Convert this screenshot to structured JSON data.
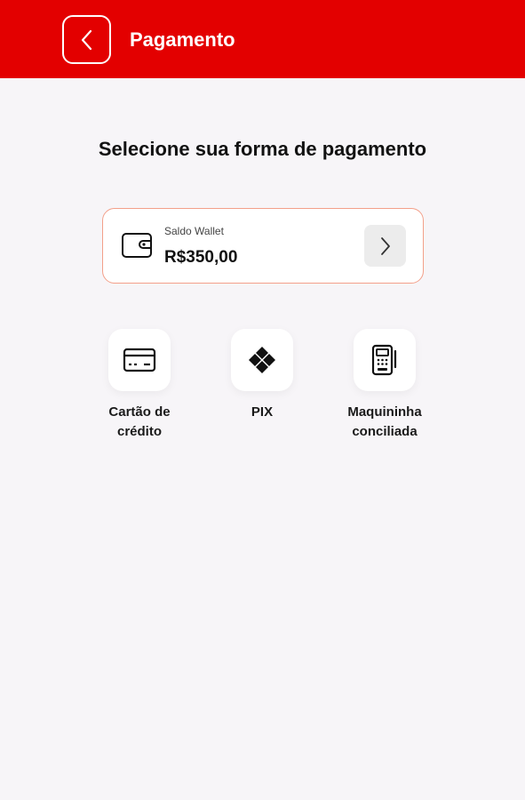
{
  "header": {
    "title": "Pagamento",
    "background": "#e30000",
    "back_icon": "chevron-left-icon"
  },
  "main": {
    "heading": "Selecione sua forma de pagamento",
    "wallet": {
      "label": "Saldo Wallet",
      "value": "R$350,00",
      "icon": "wallet-icon",
      "arrow_icon": "chevron-right-icon",
      "border_color": "#f3a08a"
    },
    "methods": [
      {
        "label": "Cartão de\ncrédito",
        "icon": "credit-card-icon"
      },
      {
        "label": "PIX",
        "icon": "pix-icon"
      },
      {
        "label": "Maquininha\nconciliada",
        "icon": "card-machine-icon"
      }
    ]
  }
}
